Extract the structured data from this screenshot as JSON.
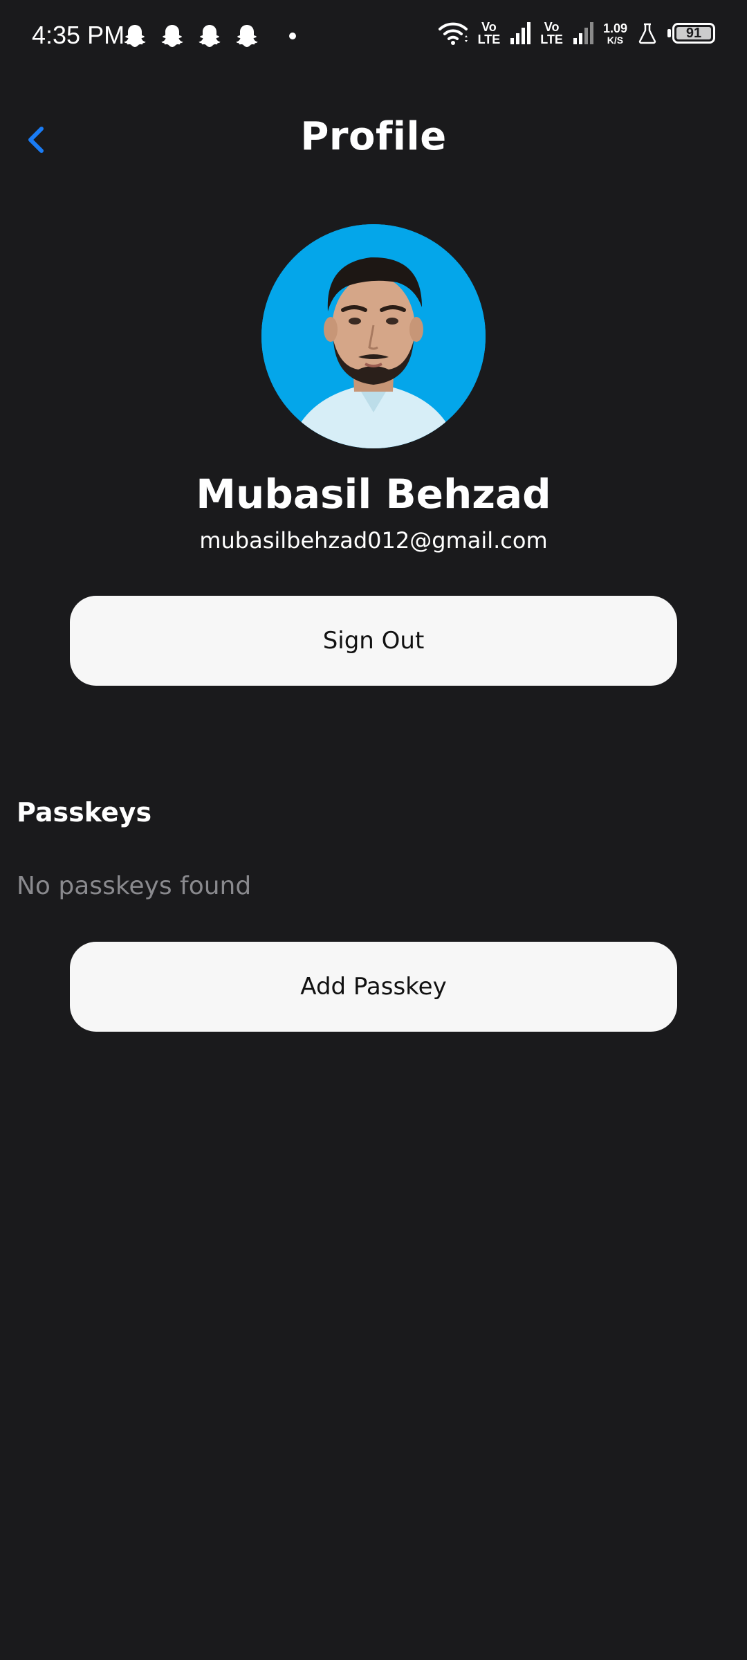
{
  "status_bar": {
    "time": "4:35 PM",
    "network_speed_value": "1.09",
    "network_speed_unit": "K/S",
    "sim1_top": "Vo",
    "sim1_bottom": "LTE",
    "sim2_top": "Vo",
    "sim2_bottom": "LTE",
    "battery_level": "91",
    "notification_icons": [
      "snapchat-icon",
      "snapchat-icon",
      "snapchat-icon",
      "snapchat-icon"
    ]
  },
  "header": {
    "title": "Profile",
    "back_icon": "chevron-left-icon"
  },
  "profile": {
    "name": "Mubasil Behzad",
    "email": "mubasilbehzad012@gmail.com"
  },
  "actions": {
    "sign_out_label": "Sign Out",
    "add_passkey_label": "Add Passkey"
  },
  "passkeys": {
    "title": "Passkeys",
    "empty_message": "No passkeys found"
  },
  "colors": {
    "background": "#1a1a1c",
    "accent": "#1a7cf5",
    "button_bg": "#f7f7f7",
    "avatar_bg": "#04a6ea",
    "muted_text": "#8a8a8e"
  }
}
